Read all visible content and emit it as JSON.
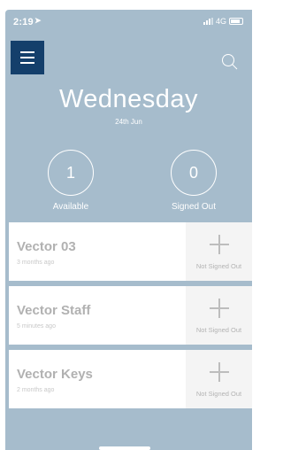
{
  "status_bar": {
    "time": "2:19",
    "location_icon": "location-arrow-icon",
    "network": "4G",
    "signal_icon": "cellular-signal-icon",
    "battery_icon": "battery-icon"
  },
  "header": {
    "menu_icon": "hamburger-menu-icon",
    "search_icon": "search-icon",
    "day": "Wednesday",
    "date": "24th Jun"
  },
  "stats": {
    "available": {
      "count": "1",
      "label": "Available"
    },
    "signed_out": {
      "count": "0",
      "label": "Signed Out"
    }
  },
  "items": [
    {
      "name": "Vector 03",
      "time": "3 months ago",
      "action_label": "Not Signed Out",
      "action_icon": "plus-icon"
    },
    {
      "name": "Vector Staff",
      "time": "5 minutes ago",
      "action_label": "Not Signed Out",
      "action_icon": "plus-icon"
    },
    {
      "name": "Vector Keys",
      "time": "2 months ago",
      "action_label": "Not Signed Out",
      "action_icon": "plus-icon"
    }
  ],
  "colors": {
    "background": "#a6bccc",
    "menu_button": "#143f6b",
    "card": "#ffffff",
    "card_action": "#f4f4f4",
    "item_text": "#b1b1b1"
  }
}
